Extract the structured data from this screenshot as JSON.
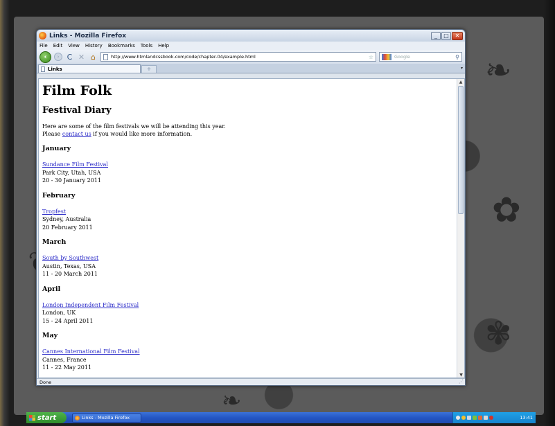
{
  "window": {
    "title": "Links - Mozilla Firefox",
    "buttons": {
      "minimize": "_",
      "maximize": "□",
      "close": "✕"
    }
  },
  "menu": [
    "File",
    "Edit",
    "View",
    "History",
    "Bookmarks",
    "Tools",
    "Help"
  ],
  "navigation": {
    "back_glyph": "‹",
    "forward_glyph": "›",
    "reload_glyph": "C",
    "stop_glyph": "✕",
    "home_glyph": "⌂",
    "url": "http://www.htmlandcssbook.com/code/chapter-04/example.html",
    "bookmark_star": "☆",
    "search_placeholder": "Google",
    "search_glyph": "⚲"
  },
  "tabs": [
    {
      "label": "Links"
    }
  ],
  "new_tab_glyph": "+",
  "page": {
    "title": "Film Folk",
    "subtitle": "Festival Diary",
    "intro_line1": "Here are some of the film festivals we will be attending this year.",
    "intro_line2_prefix": "Please ",
    "intro_link": "contact us",
    "intro_line2_suffix": " if you would like more information.",
    "months": [
      {
        "name": "January",
        "event": "Sundance Film Festival",
        "location": "Park City, Utah, USA",
        "dates": "20 - 30 January 2011"
      },
      {
        "name": "February",
        "event": "Tropfest",
        "location": "Sydney, Australia",
        "dates": "20 February 2011"
      },
      {
        "name": "March",
        "event": "South by Southwest",
        "location": "Austin, Texas, USA",
        "dates": "11 - 20 March 2011"
      },
      {
        "name": "April",
        "event": "London Independent Film Festival",
        "location": "London, UK",
        "dates": "15 - 24 April 2011"
      },
      {
        "name": "May",
        "event": "Cannes International Film Festival",
        "location": "Cannes, France",
        "dates": "11 - 22 May 2011"
      }
    ]
  },
  "status": "Done",
  "taskbar": {
    "start_label": "start",
    "task_label": "Links - Mozilla Firefox",
    "clock": "13:41"
  },
  "colors": {
    "link": "#2a2ac8",
    "titlebar": "#c7d4e4",
    "taskbar": "#2456c4",
    "start": "#2f8c2a"
  }
}
